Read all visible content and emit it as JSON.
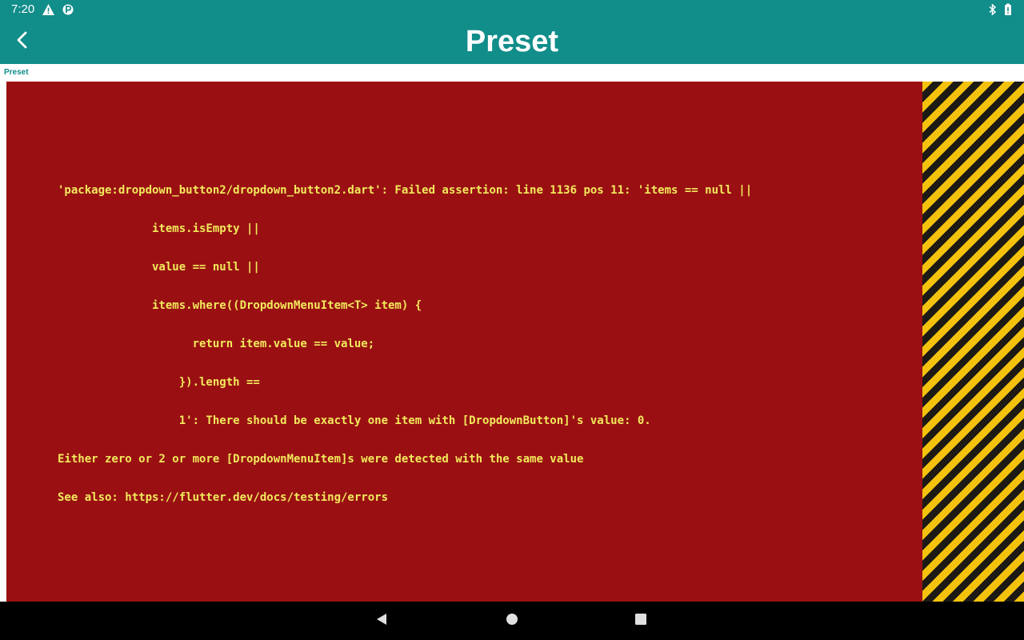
{
  "status_bar": {
    "time": "7:20",
    "left_icons": [
      "warning-icon",
      "parking-icon"
    ],
    "right_icons": [
      "bluetooth-icon",
      "battery-icon"
    ]
  },
  "app_bar": {
    "title": "Preset",
    "back_icon": "chevron-left-icon"
  },
  "breadcrumb": {
    "label": "Preset"
  },
  "error": {
    "lines": [
      "'package:dropdown_button2/dropdown_button2.dart': Failed assertion: line 1136 pos 11: 'items == null ||",
      "              items.isEmpty ||",
      "              value == null ||",
      "              items.where((DropdownMenuItem<T> item) {",
      "                    return item.value == value;",
      "                  }).length ==",
      "                  1': There should be exactly one item with [DropdownButton]'s value: 0.",
      "Either zero or 2 or more [DropdownMenuItem]s were detected with the same value",
      "See also: https://flutter.dev/docs/testing/errors"
    ]
  },
  "nav_bar": {
    "buttons": [
      "back-triangle-icon",
      "home-circle-icon",
      "recents-square-icon"
    ]
  },
  "colors": {
    "app_bar": "#118d8a",
    "error_background": "#9a1012",
    "error_text": "#f2e95c",
    "hazard_yellow": "#f4c20d",
    "hazard_dark": "#1d1a15"
  }
}
